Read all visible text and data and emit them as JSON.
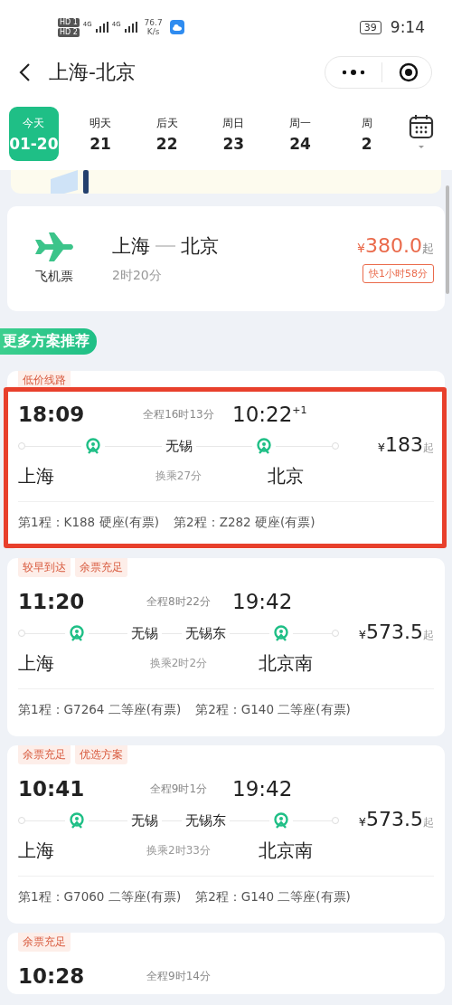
{
  "status_bar": {
    "sim_labels": [
      "HD 1",
      "HD 2"
    ],
    "networks": [
      "4G",
      "4G"
    ],
    "speed": "76.7",
    "speed_unit": "K/s",
    "battery": "39",
    "time": "9:14"
  },
  "header": {
    "title": "上海-北京"
  },
  "dates": [
    {
      "day": "今天",
      "date": "01-20",
      "selected": true
    },
    {
      "day": "明天",
      "date": "21",
      "selected": false
    },
    {
      "day": "后天",
      "date": "22",
      "selected": false
    },
    {
      "day": "周日",
      "date": "23",
      "selected": false
    },
    {
      "day": "周一",
      "date": "24",
      "selected": false
    },
    {
      "day": "周",
      "date": "2",
      "selected": false
    }
  ],
  "flight": {
    "label": "飞机票",
    "from": "上海",
    "to": "北京",
    "duration": "2时20分",
    "currency": "¥",
    "price": "380.0",
    "suffix": "起",
    "badge": "快1小时58分"
  },
  "section_title": "更多方案推荐",
  "plans": [
    {
      "tags": [
        "低价线路"
      ],
      "depart": "18:09",
      "total": "全程16时13分",
      "arrive": "10:22",
      "next_day": "+1",
      "from": "上海",
      "transfers": [
        "无锡"
      ],
      "wait": "换乘27分",
      "to": "北京",
      "currency": "¥",
      "price": "183",
      "suffix": "起",
      "legs": [
        "第1程：K188 硬座(有票)",
        "第2程：Z282 硬座(有票)"
      ]
    },
    {
      "tags": [
        "较早到达",
        "余票充足"
      ],
      "depart": "11:20",
      "total": "全程8时22分",
      "arrive": "19:42",
      "from": "上海",
      "transfers": [
        "无锡",
        "无锡东"
      ],
      "wait": "换乘2时2分",
      "to": "北京南",
      "currency": "¥",
      "price": "573.5",
      "suffix": "起",
      "legs": [
        "第1程：G7264 二等座(有票)",
        "第2程：G140 二等座(有票)"
      ]
    },
    {
      "tags": [
        "余票充足",
        "优选方案"
      ],
      "depart": "10:41",
      "total": "全程9时1分",
      "arrive": "19:42",
      "from": "上海",
      "transfers": [
        "无锡",
        "无锡东"
      ],
      "wait": "换乘2时33分",
      "to": "北京南",
      "currency": "¥",
      "price": "573.5",
      "suffix": "起",
      "legs": [
        "第1程：G7060 二等座(有票)",
        "第2程：G140 二等座(有票)"
      ]
    },
    {
      "tags": [
        "余票充足"
      ],
      "depart": "10:28",
      "total": "全程9时14分"
    }
  ]
}
